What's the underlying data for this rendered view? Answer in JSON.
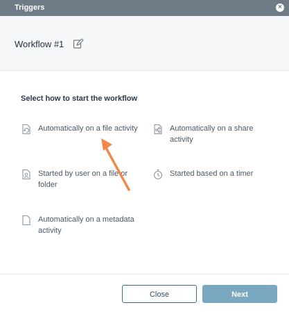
{
  "dialog": {
    "title": "Triggers",
    "close_icon": "close-icon"
  },
  "workflow": {
    "name": "Workflow #1",
    "edit_icon": "pencil-edit-icon"
  },
  "section_title": "Select how to start the workflow",
  "options": [
    {
      "label": "Automatically on a file activity",
      "icon": "file-activity-icon"
    },
    {
      "label": "Automatically on a share activity",
      "icon": "share-activity-icon"
    },
    {
      "label": "Started by user on a file or folder",
      "icon": "user-file-icon"
    },
    {
      "label": "Started based on a timer",
      "icon": "timer-icon"
    },
    {
      "label": "Automatically on a metadata activity",
      "icon": "metadata-icon"
    }
  ],
  "buttons": {
    "close": "Close",
    "next": "Next"
  },
  "colors": {
    "titlebar": "#6f7b86",
    "arrow": "#f08a4b",
    "next_button": "#7aa8c0",
    "close_border": "#3d6e8e"
  }
}
